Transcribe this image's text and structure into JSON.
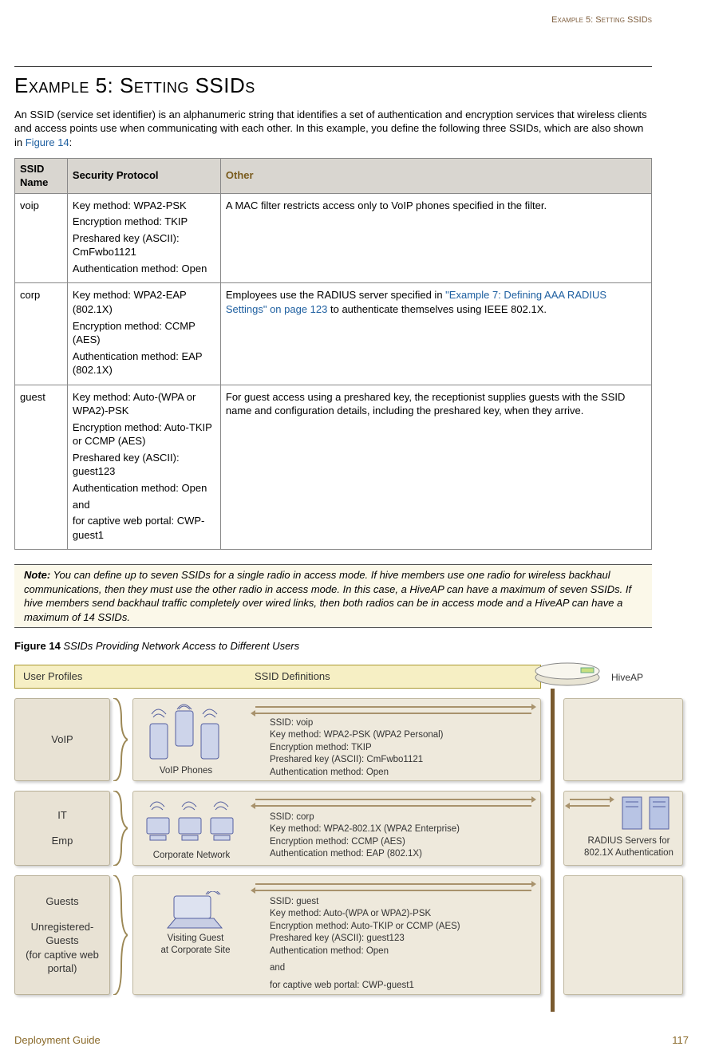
{
  "header": {
    "running": "Example 5: Setting SSIDs"
  },
  "title": "Example 5: Setting SSIDs",
  "intro": {
    "text": "An SSID (service set identifier) is an alphanumeric string that identifies a set of authentication and encryption services that wireless clients and access points use when communicating with each other. In this example, you define the following three SSIDs, which are also shown in ",
    "figlink": "Figure 14",
    "after": ":"
  },
  "table": {
    "headers": {
      "c1": "SSID Name",
      "c2": "Security Protocol",
      "c3": "Other"
    },
    "rows": [
      {
        "name": "voip",
        "sec": [
          "Key method: WPA2-PSK",
          "Encryption method: TKIP",
          "Preshared key (ASCII): CmFwbo1121",
          "Authentication method: Open"
        ],
        "other_plain": "A MAC filter restricts access only to VoIP phones specified in the filter."
      },
      {
        "name": "corp",
        "sec": [
          "Key method: WPA2-EAP (802.1X)",
          "Encryption method: CCMP (AES)",
          "Authentication method: EAP (802.1X)"
        ],
        "other_pre": "Employees use the RADIUS server specified in ",
        "other_link": "\"Example 7: Defining AAA RADIUS Settings\" on page 123",
        "other_post": " to authenticate themselves using IEEE 802.1X."
      },
      {
        "name": "guest",
        "sec": [
          "Key method: Auto-(WPA or WPA2)-PSK",
          "Encryption method: Auto-TKIP or CCMP (AES)",
          "Preshared key (ASCII): guest123",
          "Authentication method: Open",
          "and",
          "for captive web portal: CWP-guest1"
        ],
        "other_plain": "For guest access using a preshared key, the receptionist supplies guests with the SSID name and configuration details, including the preshared key, when they arrive."
      }
    ]
  },
  "note": {
    "label": "Note:",
    "text": " You can define up to seven SSIDs for a single radio in access mode. If hive members use one radio for wireless backhaul communications, then they must use the other radio in access mode. In this case, a HiveAP can have a maximum of seven SSIDs. If hive members send backhaul traffic completely over wired links, then both radios can be in access mode and a HiveAP can have a maximum of 14 SSIDs."
  },
  "figcap": {
    "num": "Figure 14",
    "title": " SSIDs Providing Network Access to Different Users"
  },
  "diagram": {
    "hdr_user": "User Profiles",
    "hdr_ssid": "SSID Definitions",
    "hiveap": "HiveAP",
    "profiles": {
      "voip": "VoIP",
      "it": "IT",
      "emp": "Emp",
      "guests": "Guests",
      "unreg": "Unregistered-Guests\n(for captive web portal)"
    },
    "devices": {
      "voip": "VoIP Phones",
      "corp": "Corporate Network",
      "guest1": "Visiting Guest",
      "guest2": "at Corporate Site"
    },
    "ssid_voip": [
      "SSID: voip",
      "Key method: WPA2-PSK (WPA2 Personal)",
      "Encryption method: TKIP",
      "Preshared key (ASCII): CmFwbo1121",
      "Authentication method: Open"
    ],
    "ssid_corp": [
      "SSID: corp",
      "Key method: WPA2-802.1X (WPA2 Enterprise)",
      "Encryption method: CCMP (AES)",
      "Authentication method: EAP (802.1X)"
    ],
    "ssid_guest": [
      "SSID: guest",
      "Key method: Auto-(WPA or WPA2)-PSK",
      "Encryption method: Auto-TKIP or CCMP (AES)",
      "Preshared key (ASCII): guest123",
      "Authentication method: Open",
      "and",
      "for captive web portal: CWP-guest1"
    ],
    "radius": "RADIUS Servers for 802.1X Authentication"
  },
  "footer": {
    "left": "Deployment Guide",
    "right": "117"
  }
}
